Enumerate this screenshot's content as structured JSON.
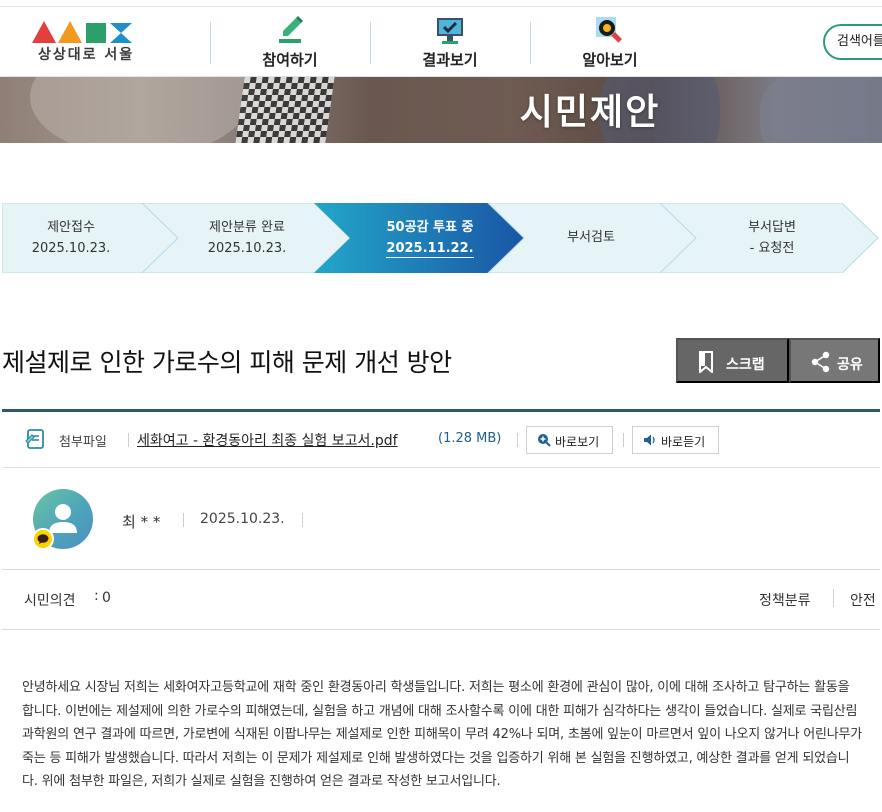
{
  "header": {
    "logo_text": "상상대로 서울",
    "nav": [
      {
        "label": "참여하기",
        "icon": "pencil-icon"
      },
      {
        "label": "결과보기",
        "icon": "monitor-check-icon"
      },
      {
        "label": "알아보기",
        "icon": "magnifier-icon"
      }
    ],
    "search_label": "검색어를"
  },
  "banner": {
    "title": "시민제안"
  },
  "steps": [
    {
      "label": "제안접수",
      "date": "2025.10.23."
    },
    {
      "label": "제안분류 완료",
      "date": "2025.10.23."
    },
    {
      "label": "50공감 투표 중",
      "date": "2025.11.22.",
      "active": true
    },
    {
      "label": "부서검토",
      "date": ""
    },
    {
      "label": "부서답변",
      "date": "- 요청전"
    }
  ],
  "proposal": {
    "title": "제설제로 인한 가로수의 피해 문제 개선 방안",
    "scrap_label": "스크랩",
    "share_label": "공유"
  },
  "attachment": {
    "label": "첨부파일",
    "file_name": "세화여고 - 환경동아리 최종 실험 보고서.pdf",
    "file_size": "(1.28 MB)",
    "view_label": "바로보기",
    "listen_label": "바로듣기"
  },
  "author": {
    "name": "최 * *",
    "date": "2025.10.23."
  },
  "opinion": {
    "label": "시민의견",
    "sep": ":",
    "count": "0",
    "policy_label": "정책분류",
    "policy_value": "안전"
  },
  "body": "안녕하세요 시장님 저희는 세화여자고등학교에 재학 중인 환경동아리 학생들입니다. 저희는 평소에 환경에 관심이 많아, 이에 대해 조사하고 탐구하는 활동을 합니다. 이번에는 제설제에 의한 가로수의 피해였는데, 실험을 하고 개념에 대해 조사할수록 이에 대한 피해가 심각하다는 생각이 들었습니다. 실제로 국립산림과학원의 연구 결과에 따르면, 가로변에 식재된 이팝나무는 제설제로 인한 피해목이 무려 42%나 되며, 초봄에 잎눈이 마르면서 잎이 나오지 않거나 어린나무가 죽는 등 피해가 발생했습니다. 따라서 저희는 이 문제가 제설제로 인해 발생하였다는 것을 입증하기 위해 본 실험을 진행하였고, 예상한 결과를 얻게 되었습니다. 위에 첨부한 파일은, 저희가 실제로 실험을 진행하여 얻은 결과로 작성한 보고서입니다.",
  "colors": {
    "accent_green": "#2a9d77",
    "step_active": "#1a5fa8",
    "step_bg": "#e6f4f8",
    "title_rule": "#2b5d68"
  }
}
